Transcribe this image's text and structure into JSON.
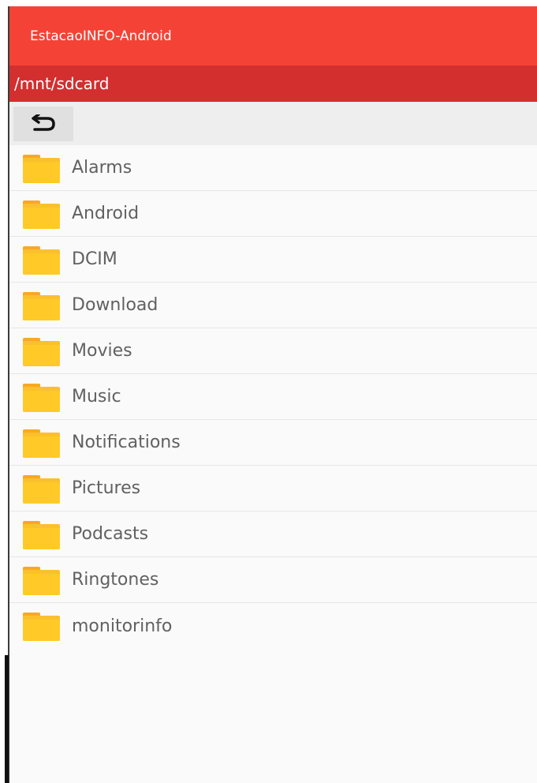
{
  "app": {
    "title": "EstacaoINFO-Android"
  },
  "path_bar": {
    "current_path": "/mnt/sdcard"
  },
  "toolbar": {
    "back_icon": "undo-arrow-icon"
  },
  "folders": [
    {
      "name": "Alarms",
      "icon": "folder-icon"
    },
    {
      "name": "Android",
      "icon": "folder-icon"
    },
    {
      "name": "DCIM",
      "icon": "folder-icon"
    },
    {
      "name": "Download",
      "icon": "folder-icon"
    },
    {
      "name": "Movies",
      "icon": "folder-icon"
    },
    {
      "name": "Music",
      "icon": "folder-icon"
    },
    {
      "name": "Notifications",
      "icon": "folder-icon"
    },
    {
      "name": "Pictures",
      "icon": "folder-icon"
    },
    {
      "name": "Podcasts",
      "icon": "folder-icon"
    },
    {
      "name": "Ringtones",
      "icon": "folder-icon"
    },
    {
      "name": "monitorinfo",
      "icon": "folder-icon"
    }
  ],
  "colors": {
    "action_bar": "#f44336",
    "path_bar": "#d32f2f",
    "folder": "#ffca28"
  }
}
